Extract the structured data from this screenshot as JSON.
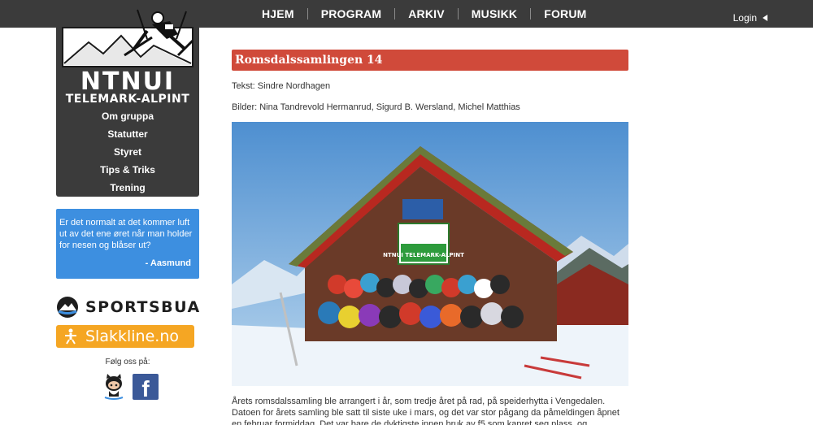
{
  "nav": {
    "items": [
      {
        "label": "HJEM"
      },
      {
        "label": "PROGRAM"
      },
      {
        "label": "ARKIV"
      },
      {
        "label": "MUSIKK"
      },
      {
        "label": "FORUM"
      }
    ],
    "login": "Login"
  },
  "sidebar": {
    "logo_title": "NTNUI",
    "logo_subtitle": "TELEMARK-ALPINT",
    "menu": [
      {
        "label": "Om gruppa"
      },
      {
        "label": "Statutter"
      },
      {
        "label": "Styret"
      },
      {
        "label": "Tips & Triks"
      },
      {
        "label": "Trening"
      }
    ],
    "quote": {
      "text": "Er det normalt at det kommer luft ut av det ene øret når man holder for nesen og blåser ut?",
      "author": "- Aasmund"
    },
    "sponsors": {
      "sportsbua": "SPORTSBUA",
      "slakkline": "Slakkline.no"
    },
    "follow_label": "Følg oss på:",
    "social": {
      "facebook_glyph": "f"
    }
  },
  "article": {
    "title": "Romsdalssamlingen 14",
    "text_credit": "Tekst: Sindre Nordhagen",
    "photo_credit": "Bilder: Nina Tandrevold Hermanrud, Sigurd B. Wersland, Michel Matthias",
    "banner_text": "NTNUI TELEMARK-ALPINT",
    "body": "Årets romsdalssamling ble arrangert i år, som tredje året på rad, på speiderhytta i Vengedalen. Datoen for årets samling ble satt til siste uke i mars, og det var stor pågang da påmeldingen åpnet en februar formiddag. Det var bare de dyktigste innen bruk av f5 som kapret seg plass, og ventelisten ble"
  },
  "colors": {
    "topbar": "#3b3b3b",
    "title_bar": "#d04a3a",
    "quote_box": "#3d8fe0",
    "slakkline": "#f5a623",
    "facebook": "#3b5998"
  }
}
